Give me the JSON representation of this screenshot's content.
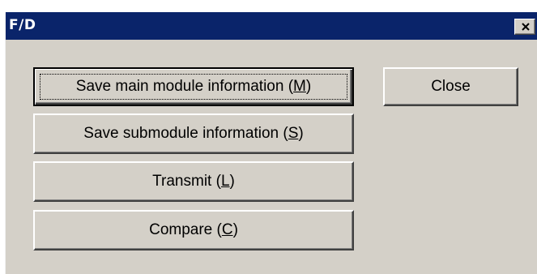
{
  "window": {
    "title": "F/D",
    "close_symbol": "×"
  },
  "buttons": {
    "save_main": {
      "text": "Save main module information (",
      "mnemonic": "M",
      "suffix": ")"
    },
    "save_sub": {
      "text": "Save submodule information (",
      "mnemonic": "S",
      "suffix": ")"
    },
    "transmit": {
      "text": "Transmit (",
      "mnemonic": "L",
      "suffix": ")"
    },
    "compare": {
      "text": "Compare (",
      "mnemonic": "C",
      "suffix": ")"
    },
    "close": {
      "label": "Close"
    }
  },
  "colors": {
    "titlebar": "#0a246a",
    "face": "#d4d0c8"
  }
}
